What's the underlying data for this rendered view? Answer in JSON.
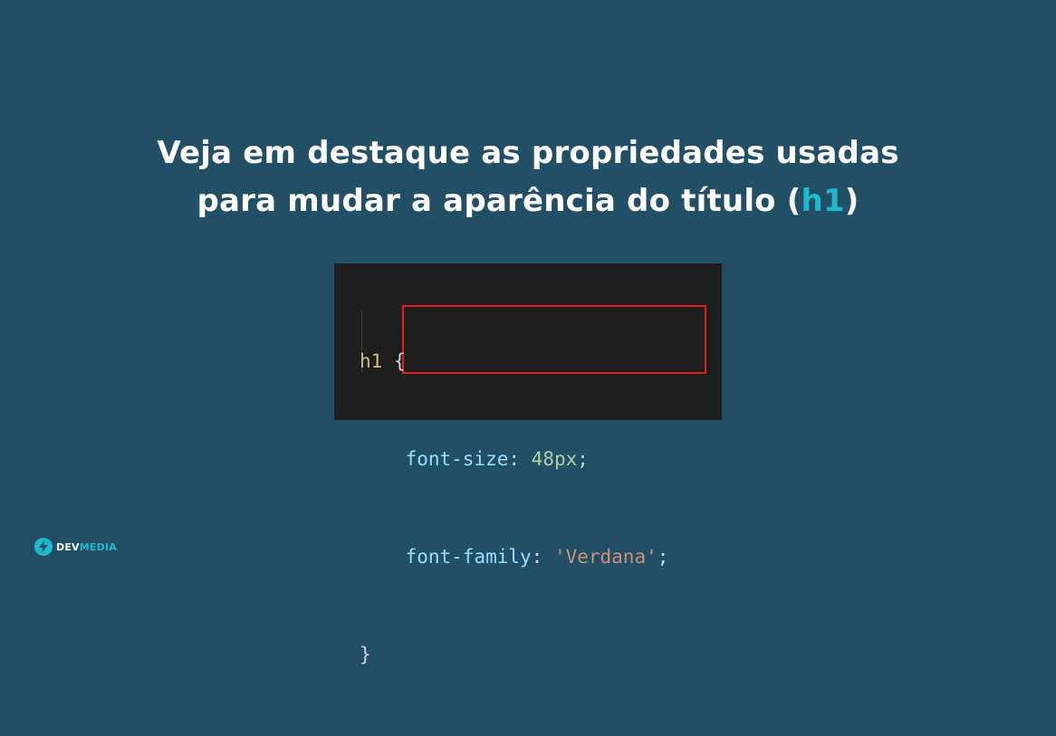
{
  "heading": {
    "line1": "Veja em destaque as propriedades usadas",
    "line2_prefix": "para mudar a aparência do título (",
    "line2_accent": "h1",
    "line2_suffix": ")"
  },
  "code": {
    "selector": "h1",
    "open_brace": " {",
    "declarations": [
      {
        "property": "font-size",
        "colon": ": ",
        "value": "48px",
        "semicolon": ";"
      },
      {
        "property": "font-family",
        "colon": ": ",
        "value": "'Verdana'",
        "semicolon": ";"
      }
    ],
    "close_brace": "}"
  },
  "logo": {
    "part1": "DEV",
    "part2": "MEDIA"
  },
  "colors": {
    "background": "#214f66",
    "accent": "#20b8cc",
    "highlight_border": "#e02020",
    "code_background": "#1e1e1e"
  }
}
